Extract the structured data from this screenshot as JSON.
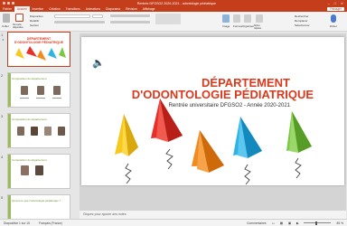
{
  "window": {
    "title": "Rentrée DFGSO2 2020-2021 - odontologie pédiatrique"
  },
  "menu": {
    "tabs": [
      "Fichier",
      "Accueil",
      "Insertion",
      "Création",
      "Transitions",
      "Animations",
      "Diaporama",
      "Révision",
      "Affichage"
    ],
    "active": "Accueil",
    "share": "Partager"
  },
  "ribbon": {
    "paste": "Coller",
    "new_slide": "Nouvelle diapositive",
    "layout": "Disposition",
    "reset": "Rétablir",
    "section": "Section",
    "shapes": "Formes",
    "arrange": "Organiser",
    "quick_styles": "Styles rapides",
    "image": "Image",
    "find": "Rechercher",
    "replace": "Remplacer",
    "select": "Sélectionner",
    "dictate": "Dicter"
  },
  "slides": {
    "thumb1": {
      "num": "1",
      "title_a": "DÉPARTEMENT",
      "title_b": "D'ODONTOLOGIE PÉDIATRIQUE"
    },
    "thumb2": {
      "num": "2",
      "title": "Composition du département"
    },
    "thumb3": {
      "num": "3",
      "title": "Composition du département"
    },
    "thumb4": {
      "num": "4",
      "title": "Composition du département"
    },
    "thumb5": {
      "num": "5",
      "title": "Qu'est-ce que l'odontologie pédiatrique ?"
    }
  },
  "slide": {
    "title_line1": "DÉPARTEMENT",
    "title_line2": "D'ODONTOLOGIE PÉDIATRIQUE",
    "subtitle": "Rentrée universitaire DFGSO2 - Année 2020-2021",
    "plane_colors": [
      "#f7c81e",
      "#e8302a",
      "#f28a1e",
      "#2fb4e6",
      "#7ac943"
    ]
  },
  "notes": {
    "placeholder": "Cliquez pour ajouter des notes"
  },
  "status": {
    "slide_count": "Diapositive 1 sur 15",
    "language": "Français (France)",
    "notes": "Commentaires",
    "zoom": "85 %"
  }
}
